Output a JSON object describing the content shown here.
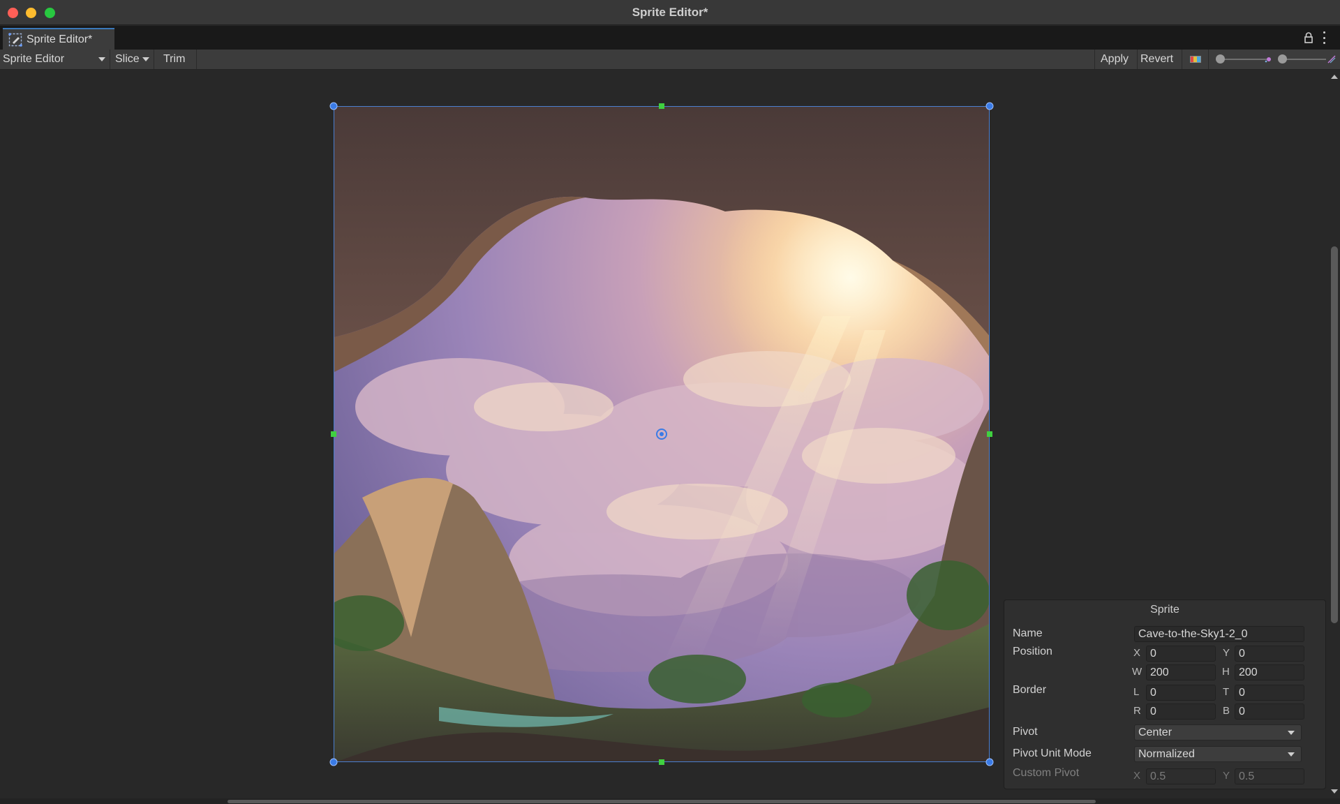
{
  "window": {
    "title": "Sprite Editor*"
  },
  "tab": {
    "label": "Sprite Editor*"
  },
  "toolbar": {
    "mode": "Sprite Editor",
    "slice": "Slice",
    "trim": "Trim",
    "apply": "Apply",
    "revert": "Revert"
  },
  "panel": {
    "title": "Sprite",
    "name_label": "Name",
    "name_value": "Cave-to-the-Sky1-2_0",
    "position_label": "Position",
    "position": {
      "x_axis": "X",
      "x": "0",
      "y_axis": "Y",
      "y": "0",
      "w_axis": "W",
      "w": "200",
      "h_axis": "H",
      "h": "200"
    },
    "border_label": "Border",
    "border": {
      "l_axis": "L",
      "l": "0",
      "t_axis": "T",
      "t": "0",
      "r_axis": "R",
      "r": "0",
      "b_axis": "B",
      "b": "0"
    },
    "pivot_label": "Pivot",
    "pivot_value": "Center",
    "pivot_unit_label": "Pivot Unit Mode",
    "pivot_unit_value": "Normalized",
    "custom_pivot_label": "Custom Pivot",
    "custom_pivot": {
      "x_axis": "X",
      "x": "0.5",
      "y_axis": "Y",
      "y": "0.5"
    }
  },
  "colors": {
    "selection": "#4a7fd0",
    "handle_corner": "#3a7be6",
    "handle_edge": "#40d040",
    "tab_accent": "#3a79bb"
  },
  "icons": {
    "tab": "sprite-editor-icon",
    "lock": "lock-icon",
    "menu": "kebab-icon",
    "color_channels": "color-channel-icon",
    "mip": "mip-level-icon"
  }
}
